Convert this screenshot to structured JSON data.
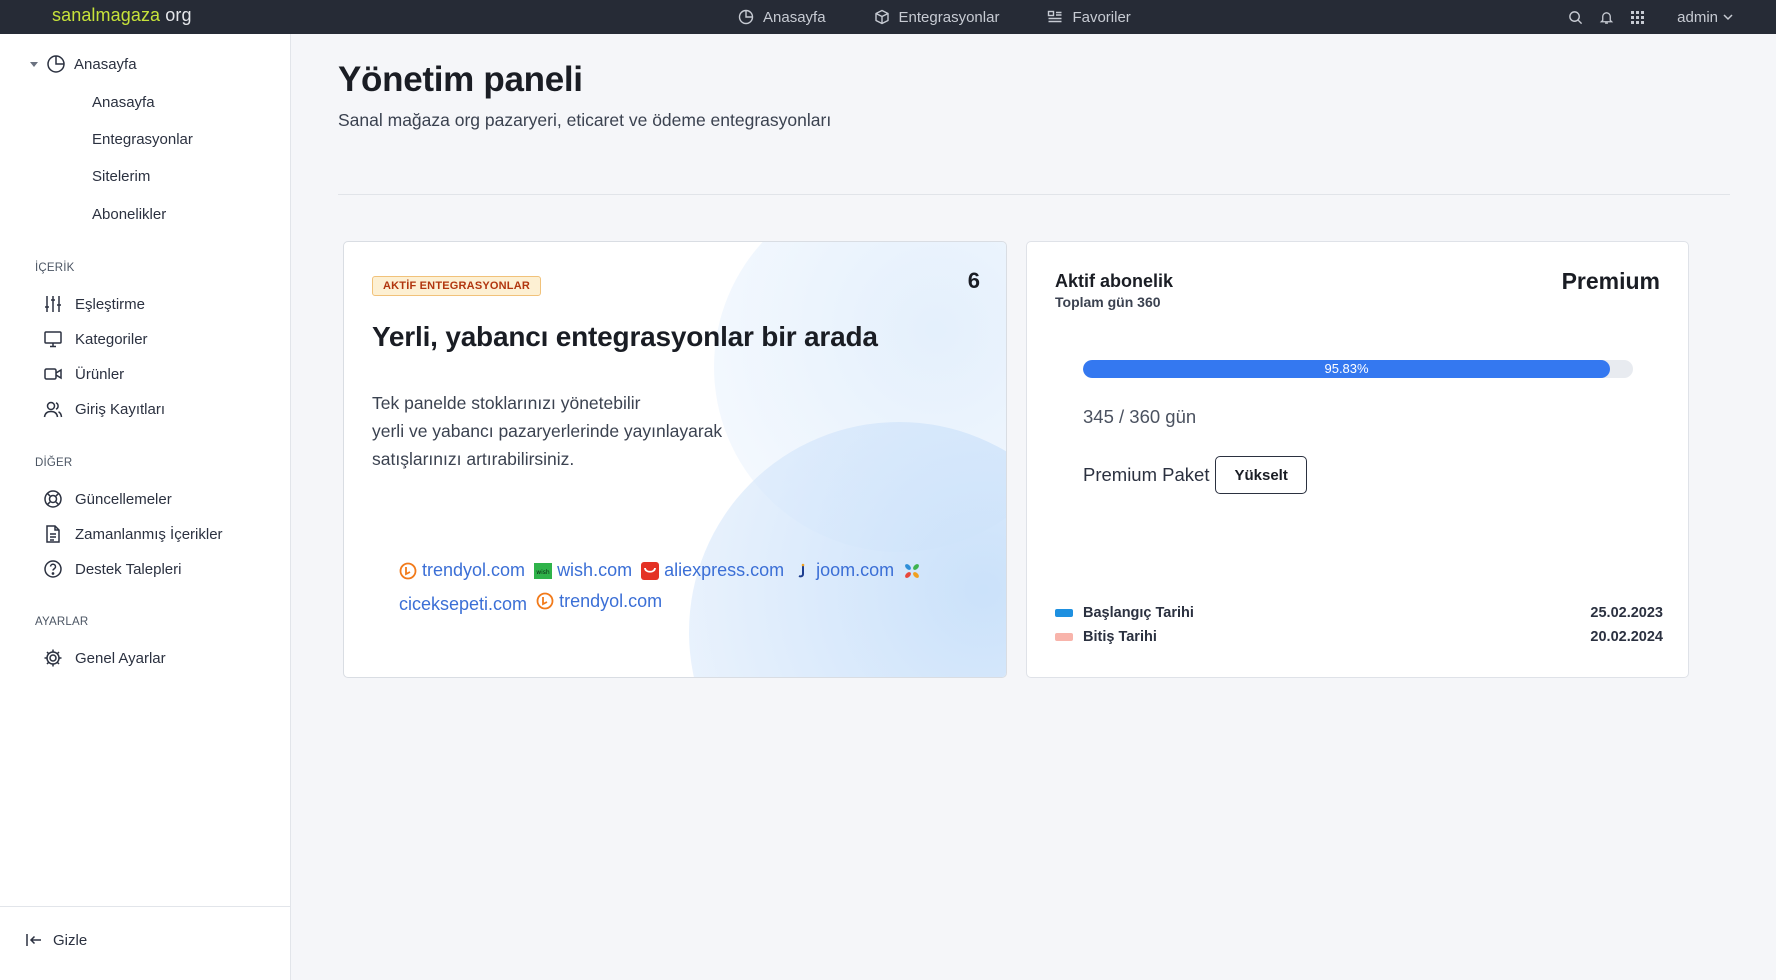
{
  "brand": {
    "part1": "sanalmagaza",
    "part2": " org"
  },
  "topnav": {
    "items": [
      {
        "label": "Anasayfa",
        "icon": "chart-pie-icon"
      },
      {
        "label": "Entegrasyonlar",
        "icon": "cube-icon"
      },
      {
        "label": "Favoriler",
        "icon": "list-icon"
      }
    ]
  },
  "topright": {
    "user": "admin"
  },
  "sidebar": {
    "parent": "Anasayfa",
    "subitems": [
      "Anasayfa",
      "Entegrasyonlar",
      "Sitelerim",
      "Abonelikler"
    ],
    "sections": [
      {
        "title": "İÇERİK",
        "items": [
          "Eşleştirme",
          "Kategoriler",
          "Ürünler",
          "Giriş Kayıtları"
        ]
      },
      {
        "title": "DİĞER",
        "items": [
          "Güncellemeler",
          "Zamanlanmış İçerikler",
          "Destek Talepleri"
        ]
      },
      {
        "title": "AYARLAR",
        "items": [
          "Genel Ayarlar"
        ]
      }
    ],
    "hide_label": "Gizle"
  },
  "main": {
    "title": "Yönetim paneli",
    "subtitle": "Sanal mağaza org pazaryeri, eticaret ve ödeme entegrasyonları"
  },
  "integrations_card": {
    "badge": "AKTİF ENTEGRASYONLAR",
    "count": "6",
    "title": "Yerli, yabancı entegrasyonlar bir arada",
    "description_lines": [
      "Tek panelde stoklarınızı yönetebilir",
      "yerli ve yabancı pazaryerlerinde yayınlayarak",
      "satışlarınızı artırabilirsiniz."
    ],
    "links": [
      {
        "label": "trendyol.com",
        "logo": "trendyol-logo",
        "color": "#f27a1a"
      },
      {
        "label": "wish.com",
        "logo": "wish-logo",
        "color": "#2fb34a"
      },
      {
        "label": "aliexpress.com",
        "logo": "aliexpress-logo",
        "color": "#e43225"
      },
      {
        "label": "joom.com",
        "logo": "joom-logo",
        "color": "#f0a020"
      },
      {
        "label": "ciceksepeti.com",
        "logo": "ciceksepeti-logo",
        "color": "#2f8fd8"
      },
      {
        "label": "trendyol.com",
        "logo": "trendyol-logo",
        "color": "#f27a1a"
      }
    ]
  },
  "subscription_card": {
    "title": "Aktif abonelik",
    "subtitle": "Toplam gün 360",
    "plan": "Premium",
    "progress_label": "95.83%",
    "progress_fraction": 0.9583,
    "days": "345 / 360 gün",
    "package": "Premium Paket",
    "upgrade_label": "Yükselt",
    "legend": [
      {
        "label": "Başlangıç Tarihi",
        "value": "25.02.2023",
        "color": "#1e90e0"
      },
      {
        "label": "Bitiş Tarihi",
        "value": "20.02.2024",
        "color": "#f8b4ab"
      }
    ]
  }
}
